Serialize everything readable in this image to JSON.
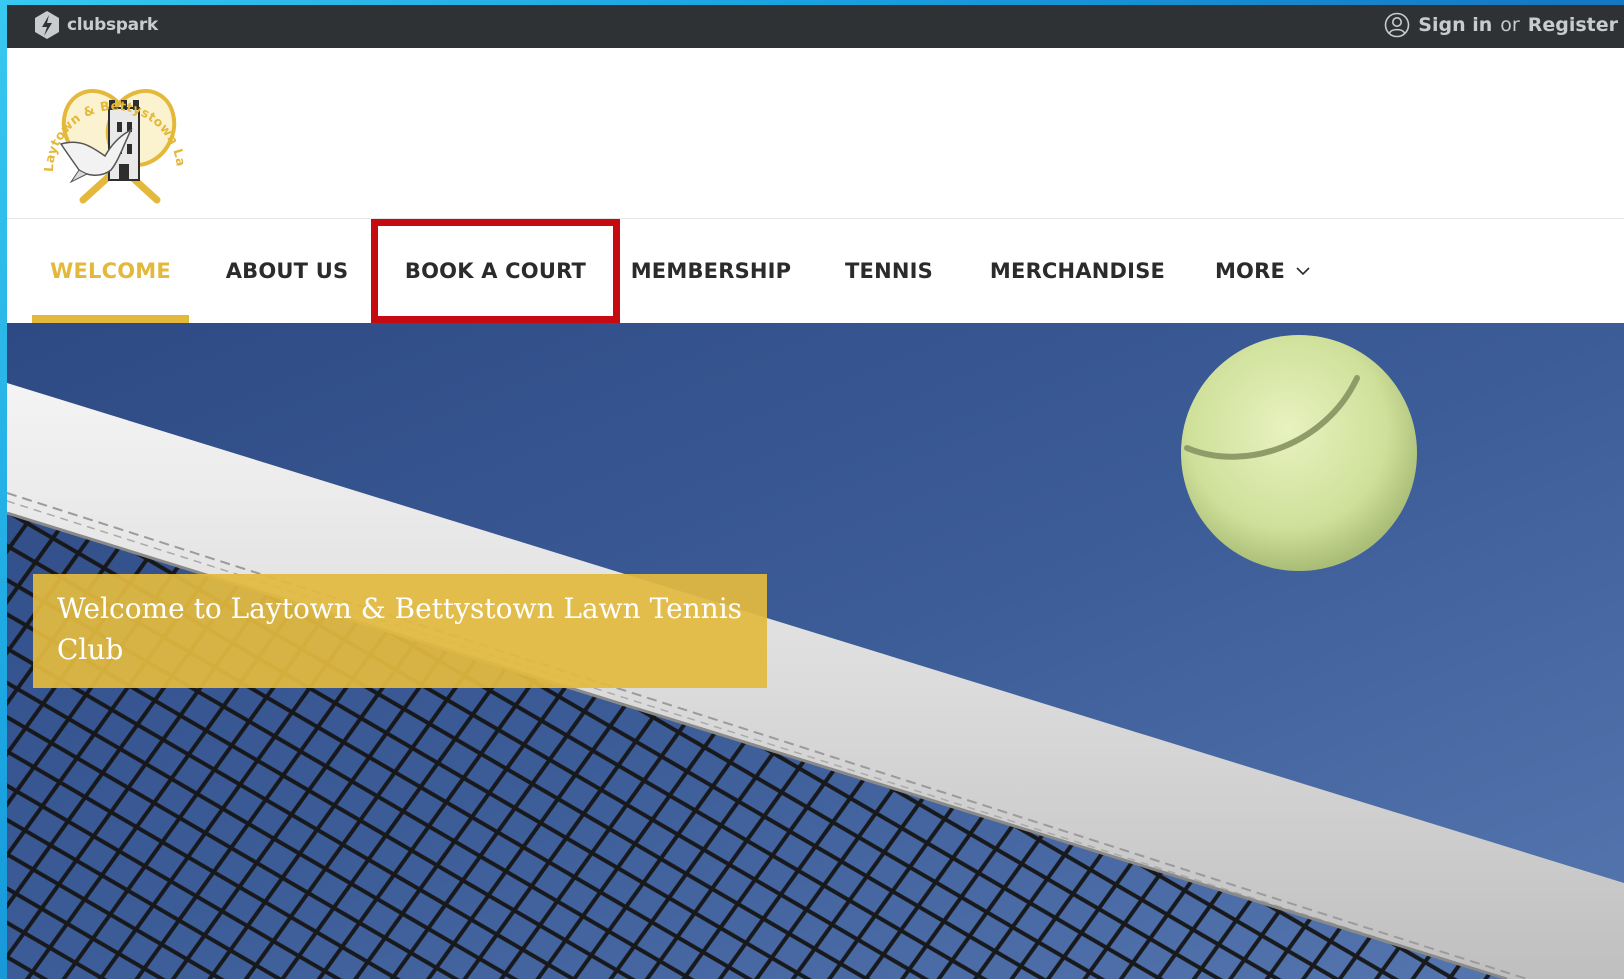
{
  "topbar": {
    "brand": "clubspark",
    "brand_icon": "clubspark-bolt-icon",
    "user_icon": "user-circle-icon",
    "sign_in": "Sign in",
    "or": "or",
    "register": "Register"
  },
  "header": {
    "logo_text": "Laytown & Bettystown Lawn Tennis Club",
    "logo_alt": "club-crest"
  },
  "nav": {
    "items": [
      {
        "label": "WELCOME",
        "state": "active"
      },
      {
        "label": "ABOUT US"
      },
      {
        "label": "BOOK A COURT",
        "state": "highlighted"
      },
      {
        "label": "MEMBERSHIP"
      },
      {
        "label": "TENNIS"
      },
      {
        "label": "MERCHANDISE"
      },
      {
        "label": "MORE"
      }
    ],
    "more_icon": "chevron-down-icon"
  },
  "hero": {
    "welcome_text": "Welcome to Laytown & Bettystown Lawn Tennis Club"
  },
  "colors": {
    "accent": "#e3b83b",
    "highlight_border": "#c60a12",
    "topbar_bg": "#2f3235",
    "sky": "#3f5f99"
  }
}
